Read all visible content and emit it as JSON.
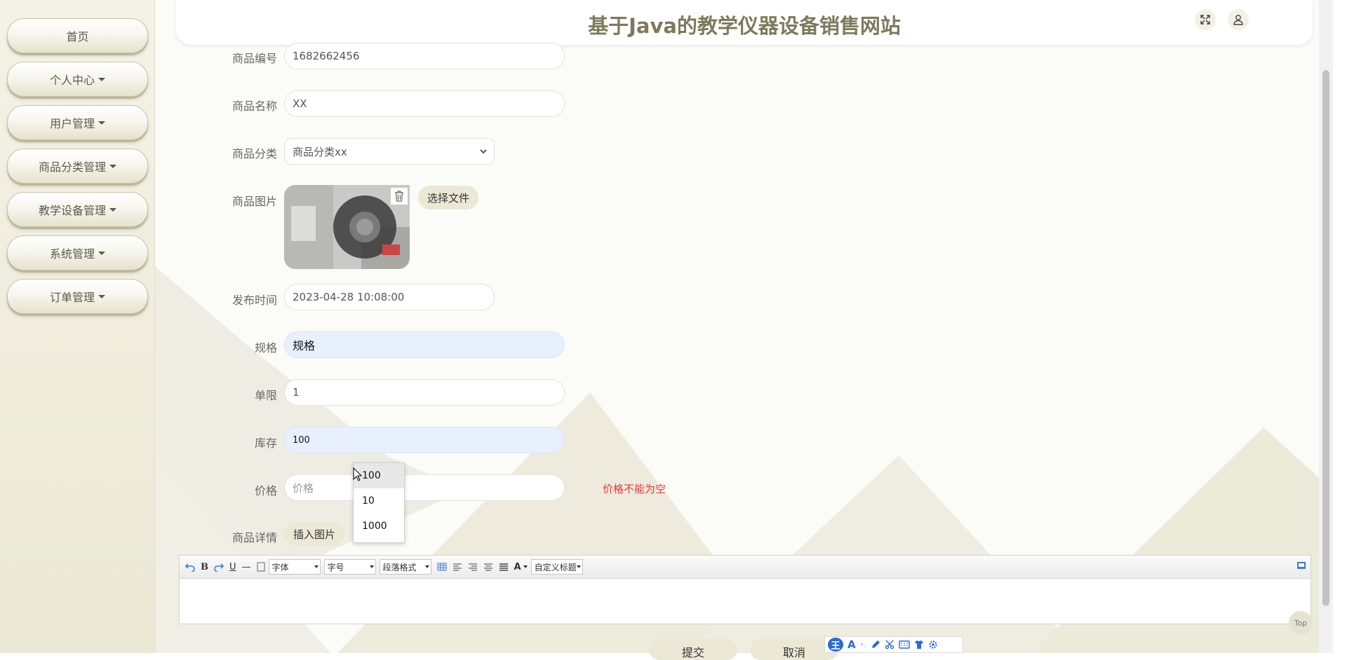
{
  "app": {
    "title": "基于Java的教学仪器设备销售网站"
  },
  "sidebar": {
    "items": [
      {
        "label": "首页"
      },
      {
        "label": "个人中心"
      },
      {
        "label": "用户管理"
      },
      {
        "label": "商品分类管理"
      },
      {
        "label": "教学设备管理"
      },
      {
        "label": "系统管理"
      },
      {
        "label": "订单管理"
      }
    ]
  },
  "header": {
    "icons": [
      "fullscreen-icon",
      "user-icon"
    ]
  },
  "form": {
    "product_code": {
      "label": "商品编号",
      "value": "1682662456"
    },
    "product_name": {
      "label": "商品名称",
      "value": "XX"
    },
    "category": {
      "label": "商品分类",
      "value": "商品分类xx"
    },
    "image": {
      "label": "商品图片",
      "choose_file": "选择文件"
    },
    "publish_time": {
      "label": "发布时间",
      "value": "2023-04-28 10:08:00"
    },
    "spec": {
      "label": "规格",
      "value": "规格"
    },
    "limit": {
      "label": "单限",
      "value": "1"
    },
    "stock": {
      "label": "库存",
      "value": "100"
    },
    "price": {
      "label": "价格",
      "placeholder": "价格",
      "error": "价格不能为空"
    },
    "detail": {
      "label": "商品详情",
      "insert_image": "插入图片"
    }
  },
  "autocomplete": {
    "options": [
      "100",
      "10",
      "1000"
    ]
  },
  "editor": {
    "font_family": "字体",
    "font_size": "字号",
    "paragraph": "段落格式",
    "custom_title": "自定义标题"
  },
  "actions": {
    "submit": "提交",
    "cancel": "取消"
  },
  "back_to_top": "Top",
  "ime": {
    "logo": "王"
  },
  "colors": {
    "accent": "#7d7a5c",
    "error": "#e4393c",
    "autofill": "#e8f0fe"
  }
}
